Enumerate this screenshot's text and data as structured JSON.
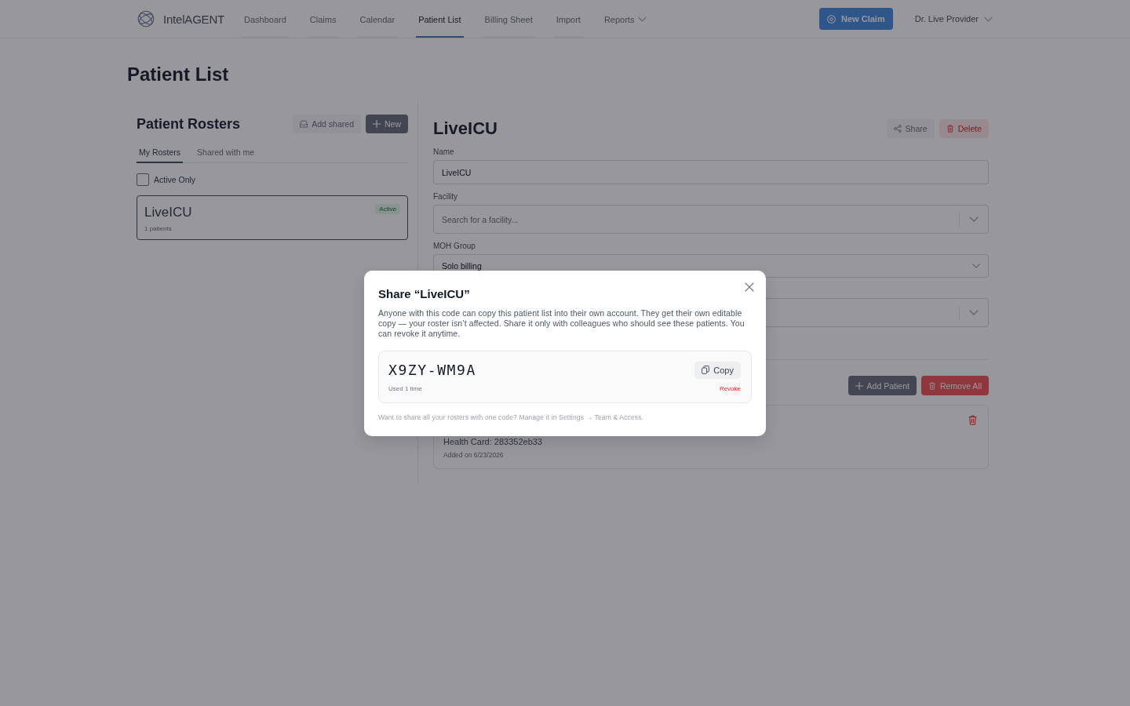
{
  "nav": {
    "logo_text": "IntelAGENT",
    "items": [
      {
        "label": "Dashboard",
        "kind": "link",
        "selected": false
      },
      {
        "label": "Claims",
        "kind": "link",
        "selected": false
      },
      {
        "label": "Calendar",
        "kind": "link",
        "selected": false
      },
      {
        "label": "Patient List",
        "kind": "link",
        "selected": true
      },
      {
        "label": "Billing Sheet",
        "kind": "link",
        "selected": false
      },
      {
        "label": "Import",
        "kind": "link",
        "selected": false
      },
      {
        "label": "Reports",
        "kind": "menu",
        "selected": false
      }
    ],
    "new_claim": "New Claim",
    "user": "Dr. Live Provider"
  },
  "page_title": "Patient List",
  "rosters_panel": {
    "title": "Patient Rosters",
    "add_shared": "Add shared",
    "new": "New",
    "tabs": [
      {
        "label": "My Rosters",
        "selected": true
      },
      {
        "label": "Shared with me",
        "selected": false
      }
    ],
    "active_only": {
      "label": "Active Only",
      "checked": false
    },
    "rosters": [
      {
        "name": "LiveICU",
        "count": "1 patients",
        "status": "Active",
        "selected": true
      }
    ]
  },
  "roster_detail": {
    "title": "LiveICU",
    "share": "Share",
    "delete": "Delete",
    "fields": [
      {
        "kind": "text",
        "label": "Name",
        "value": "LiveICU"
      },
      {
        "kind": "combo",
        "label": "Facility",
        "placeholder": "Search for a facility..."
      },
      {
        "kind": "select",
        "label": "MOH Group",
        "value": "Solo billing"
      },
      {
        "kind": "combo"
      }
    ],
    "add_patient": "Add Patient",
    "remove_all": "Remove All",
    "patients": [
      {
        "health_card": "Health Card: 283352eb33",
        "added": "Added on 6/23/2026"
      }
    ]
  },
  "share_dialog": {
    "title": "Share “LiveICU”",
    "description": "Anyone with this code can copy this patient list into their own account. They get their own editable copy — your roster isn’t affected. Share it only with colleagues who should see these patients. You can revoke it anytime.",
    "code": "X9ZY-WM9A",
    "copy": "Copy",
    "usage": "Used 1 time",
    "revoke": "Revoke",
    "footer": "Want to share all your rosters with one code? Manage it in Settings → Team & Access."
  }
}
